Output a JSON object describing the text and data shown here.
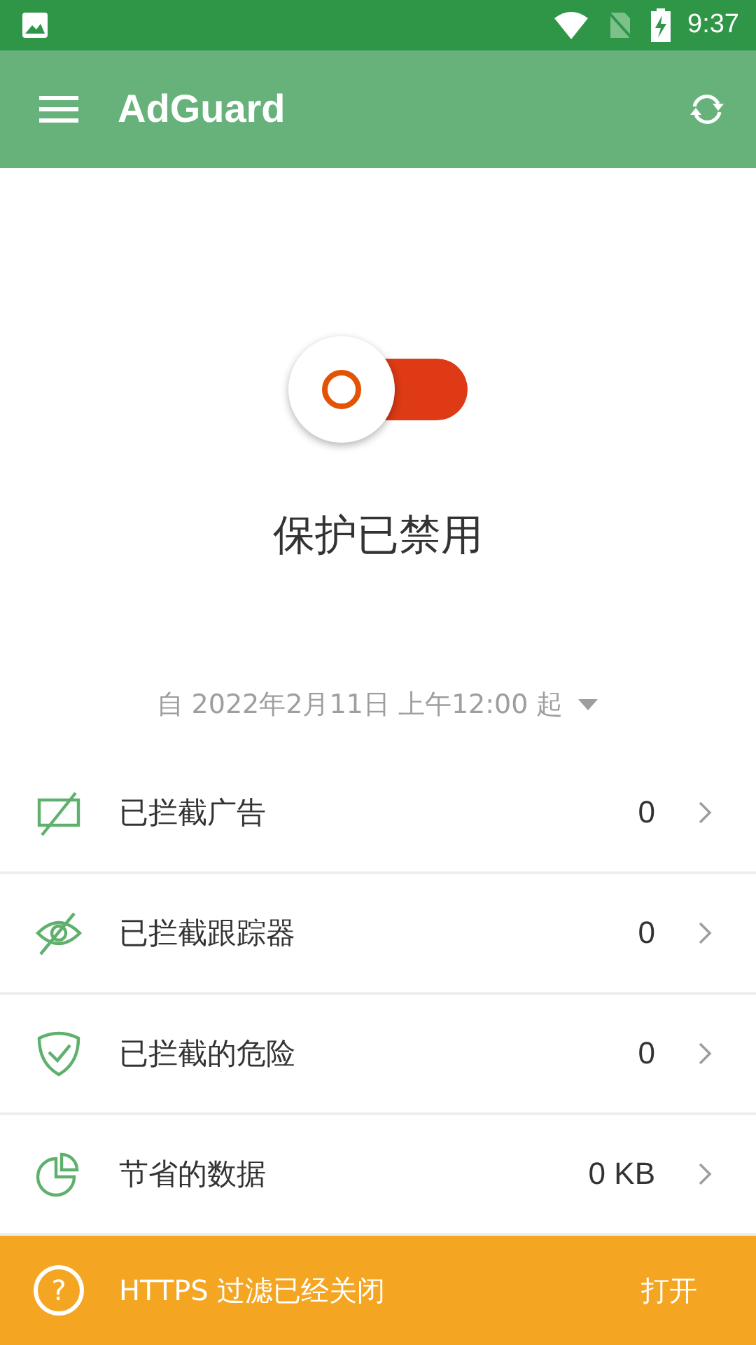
{
  "status_bar": {
    "time": "9:37"
  },
  "app_bar": {
    "title": "AdGuard"
  },
  "protection": {
    "on": false,
    "label": "保护已禁用"
  },
  "period": {
    "label": "自 2022年2月11日 上午12:00 起"
  },
  "stats": [
    {
      "kind": "ads",
      "label": "已拦截广告",
      "value": "0"
    },
    {
      "kind": "trackers",
      "label": "已拦截跟踪器",
      "value": "0"
    },
    {
      "kind": "threats",
      "label": "已拦截的危险",
      "value": "0"
    },
    {
      "kind": "data",
      "label": "节省的数据",
      "value": "0 KB"
    }
  ],
  "banner": {
    "icon": "?",
    "message": "HTTPS 过滤已经关闭",
    "action": "打开"
  }
}
